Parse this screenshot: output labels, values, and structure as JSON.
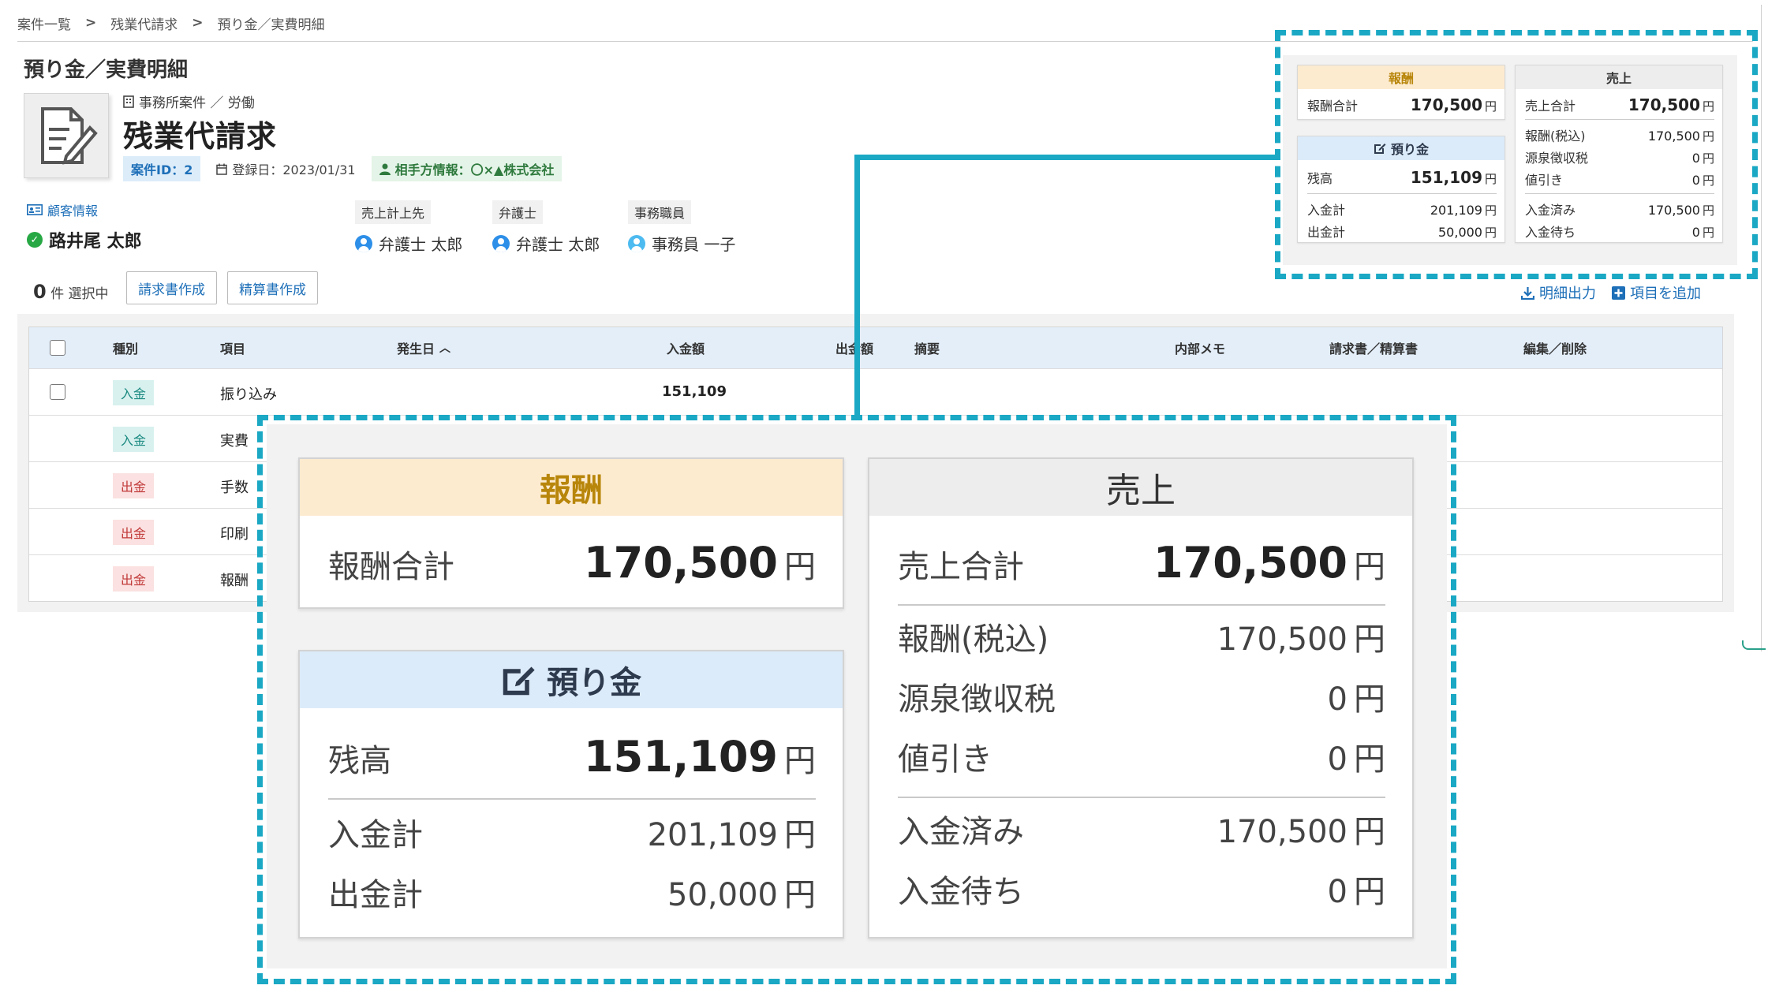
{
  "breadcrumb": [
    "案件一覧",
    "残業代請求",
    "預り金／実費明細"
  ],
  "breadcrumb_sep": ">",
  "page_title": "預り金／実費明細",
  "case": {
    "category": "事務所案件 ／ 労働",
    "name": "残業代請求",
    "id_label": "案件ID：2",
    "registered_label": "登録日：2023/01/31",
    "party_label": "相手方情報：〇×▲株式会社"
  },
  "people": {
    "client_label": "顧客情報",
    "client_name": "路井尾 太郎",
    "sales_label": "売上計上先",
    "sales_name": "弁護士 太郎",
    "lawyer_label": "弁護士",
    "lawyer_name": "弁護士 太郎",
    "staff_label": "事務職員",
    "staff_name": "事務員 一子"
  },
  "selection": {
    "count": "0",
    "suffix": "件 選択中"
  },
  "buttons": {
    "invoice": "請求書作成",
    "settlement": "精算書作成"
  },
  "actions": {
    "export": "明細出力",
    "add_item": "項目を追加"
  },
  "table": {
    "headers": {
      "kind": "種別",
      "item": "項目",
      "date": "発生日",
      "income": "入金額",
      "expense": "出金額",
      "summary": "摘要",
      "memo": "内部メモ",
      "invoice": "請求書／精算書",
      "edit": "編集／削除"
    },
    "rows": [
      {
        "kind": "入金",
        "type": "in",
        "item": "振り込み",
        "income": "151,109"
      },
      {
        "kind": "入金",
        "type": "in",
        "item": "実費",
        "income": ""
      },
      {
        "kind": "出金",
        "type": "out",
        "item": "手数",
        "income": ""
      },
      {
        "kind": "出金",
        "type": "out",
        "item": "印刷",
        "income": ""
      },
      {
        "kind": "出金",
        "type": "out",
        "item": "報酬",
        "income": ""
      }
    ]
  },
  "summary": {
    "yen": "円",
    "fee": {
      "title": "報酬",
      "total_label": "報酬合計",
      "total": "170,500"
    },
    "deposit": {
      "title": "預り金",
      "balance_label": "残高",
      "balance": "151,109",
      "in_label": "入金計",
      "in": "201,109",
      "out_label": "出金計",
      "out": "50,000"
    },
    "sales": {
      "title": "売上",
      "total_label": "売上合計",
      "total": "170,500",
      "fee_tax_label": "報酬(税込)",
      "fee_tax": "170,500",
      "withholding_label": "源泉徴収税",
      "withholding": "0",
      "discount_label": "値引き",
      "discount": "0",
      "paid_label": "入金済み",
      "paid": "170,500",
      "pending_label": "入金待ち",
      "pending": "0"
    }
  },
  "colors": {
    "accent": "#1aa8c4",
    "link": "#1d6fb8",
    "fee_header": "#fdebd0",
    "deposit_header": "#dcebf9",
    "sales_header": "#ededed"
  }
}
